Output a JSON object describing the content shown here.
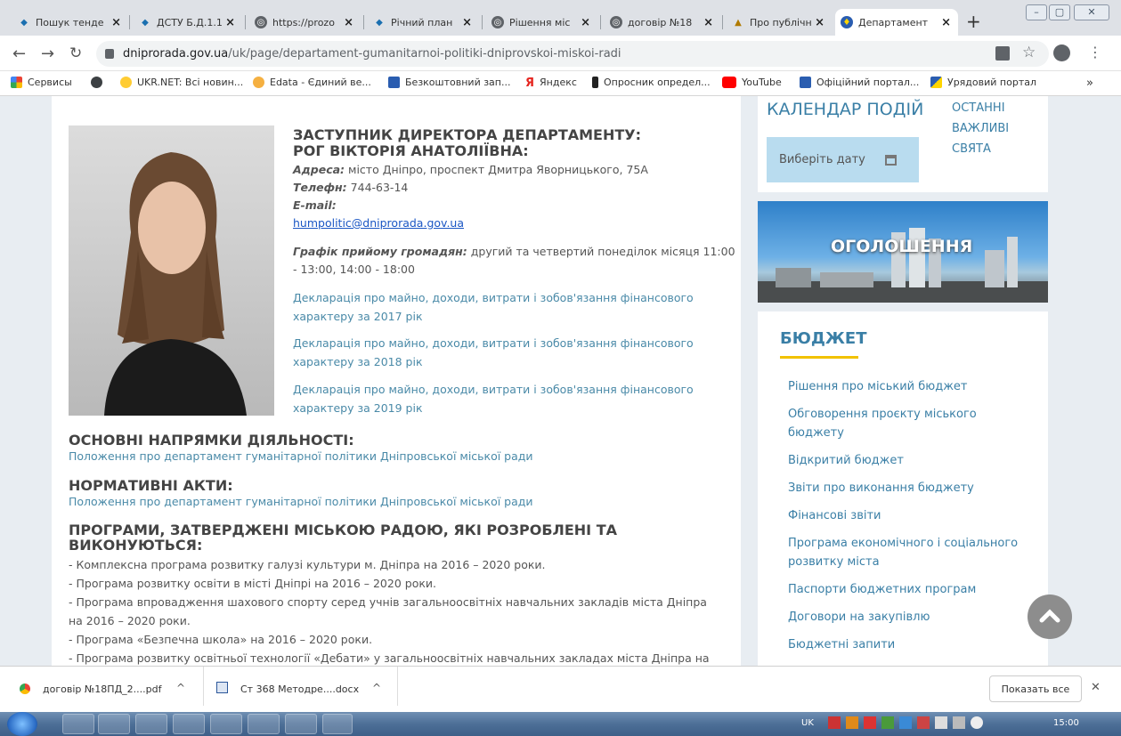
{
  "tabs": [
    {
      "label": "Пошук тенде",
      "icon": "prozorro-icon"
    },
    {
      "label": "ДСТУ Б.Д.1.1-",
      "icon": "prozorro-icon"
    },
    {
      "label": "https://prozo",
      "icon": "globe-icon"
    },
    {
      "label": "Річний план",
      "icon": "prozorro-icon"
    },
    {
      "label": "Рішення міс",
      "icon": "globe-icon"
    },
    {
      "label": "договір №18",
      "icon": "globe-icon"
    },
    {
      "label": "Про публічні",
      "icon": "building-icon"
    },
    {
      "label": "Департамент",
      "icon": "shield-icon"
    }
  ],
  "tab_close": "×",
  "new_tab": "+",
  "window": {
    "min": "–",
    "max": "▢",
    "close": "✕"
  },
  "address": {
    "host": "dniprorada.gov.ua",
    "path": "/uk/page/departament-gumanitarnoi-politiki-dniprovskoi-miskoi-radi"
  },
  "bookmarks": [
    "Сервисы",
    "UKR.NET: Всі новин...",
    "Edata - Єдиний ве...",
    "Безкоштовний зап...",
    "Яндекс",
    "Опросник определ...",
    "YouTube",
    "Офіційний портал...",
    "Урядовий портал"
  ],
  "bookmarks_more": "»",
  "deputy": {
    "title1": "ЗАСТУПНИК ДИРЕКТОРА ДЕПАРТАМЕНТУ:",
    "title2": "РОГ ВІКТОРІЯ АНАТОЛІЇВНА:",
    "address_label": "Адреса:",
    "address": " місто Дніпро, проспект Дмитра Яворницького, 75А",
    "phone_label": "Телефн:",
    "phone": " 744-63-14",
    "email_label": "E-mail:",
    "email": "humpolitic@dniprorada.gov.ua",
    "schedule_label": "Графік прийому громадян:",
    "schedule": " другий та четвертий понеділок місяця 11:00",
    "schedule2": "- 13:00, 14:00 - 18:00",
    "decl": [
      {
        "l1": "Декларація про майно, доходи, витрати і зобов'язання фінансового",
        "l2": "характеру за 2017 рік"
      },
      {
        "l1": "Декларація про майно, доходи, витрати і зобов'язання фінансового",
        "l2": "характеру за 2018 рік"
      },
      {
        "l1": "Декларація про майно, доходи, витрати і зобов'язання фінансового",
        "l2": "характеру за 2019 рік"
      }
    ]
  },
  "sections": {
    "directions": "ОСНОВНІ НАПРЯМКИ ДІЯЛЬНОСТІ:",
    "directions_link": "Положення про департамент гуманітарної політики Дніпровської міської ради",
    "acts": "НОРМАТИВНІ АКТИ:",
    "acts_link": "Положення про департамент гуманітарної політики Дніпровської міської ради",
    "programs1": "ПРОГРАМИ, ЗАТВЕРДЖЕНІ МІСЬКОЮ РАДОЮ, ЯКІ РОЗРОБЛЕНІ ТА",
    "programs2": "ВИКОНУЮТЬСЯ:",
    "program_lines": [
      "- Комплексна програма розвитку галузі культури м. Дніпра на 2016 – 2020 роки.",
      "- Програма розвитку освіти в місті Дніпрі на 2016 – 2020 роки.",
      "- Програма впровадження шахового спорту серед учнів загальноосвітніх навчальних закладів міста Дніпра",
      "на 2016 – 2020 роки.",
      "- Програма «Безпечна школа» на 2016 – 2020 роки.",
      "- Програма розвитку освітньої технології «Дебати» у загальноосвітніх навчальних закладах міста Дніпра на"
    ]
  },
  "calendar": {
    "title": "КАЛЕНДАР ПОДІЙ",
    "date_btn": "Виберіть дату",
    "tabs": [
      "ОСТАННІ",
      "ВАЖЛИВІ",
      "СВЯТА"
    ]
  },
  "banner": "ОГОЛОШЕННЯ",
  "budget": {
    "title": "БЮДЖЕТ",
    "links": [
      {
        "l1": "Рішення про міський бюджет"
      },
      {
        "l1": "Обговорення проєкту міського",
        "l2": "бюджету"
      },
      {
        "l1": "Відкритий бюджет"
      },
      {
        "l1": "Звіти про виконання бюджету"
      },
      {
        "l1": "Фінансові звіти"
      },
      {
        "l1": "Програма економічного і соціального",
        "l2": "розвитку міста"
      },
      {
        "l1": "Паспорти бюджетних програм"
      },
      {
        "l1": "Договори на закупівлю"
      },
      {
        "l1": "Бюджетні запити"
      }
    ]
  },
  "downloads": [
    {
      "name": "договір №18ПД_2....pdf"
    },
    {
      "name": "Ст 368 Методре....docx"
    }
  ],
  "download_chevron": "^",
  "show_all": "Показать все",
  "dl_close": "✕",
  "taskbar": {
    "lang": "UK",
    "time": "15:00"
  },
  "colors": {
    "link": "#4a8aa8",
    "heading": "#444444",
    "budget_accent": "#f2c200",
    "calendar_btn": "#b9dcef"
  }
}
